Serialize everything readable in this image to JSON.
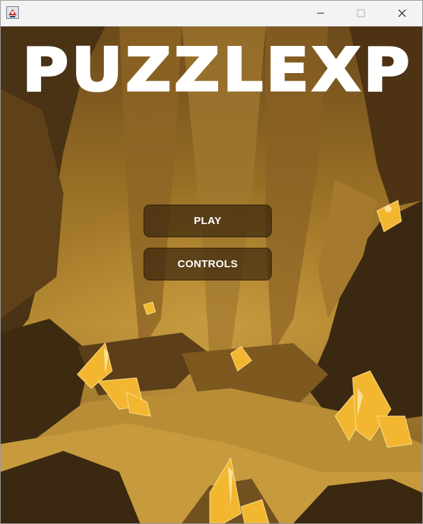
{
  "window": {
    "icon": "java-app-icon",
    "controls": {
      "minimize": "minimize-icon",
      "maximize": "maximize-icon",
      "close": "close-icon"
    }
  },
  "game": {
    "logo_text": "PUZZLEXP",
    "background": "golden-crystal-cave",
    "menu": {
      "play_label": "PLAY",
      "controls_label": "CONTROLS"
    }
  },
  "colors": {
    "titlebar": "#f3f3f3",
    "cave_dark": "#3a2a14",
    "cave_gold": "#b98a2a",
    "crystal": "#f2b631",
    "button_fill": "#301e0a",
    "button_text": "#ffffff",
    "logo": "#ffffff"
  }
}
